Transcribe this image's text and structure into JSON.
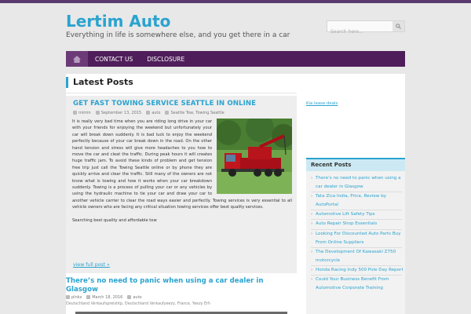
{
  "site": {
    "title": "Lertim Auto",
    "tagline": "Everything in life is somewhere else, and you get there in a car"
  },
  "search": {
    "placeholder": "Search here..."
  },
  "nav": {
    "items": [
      "CONTACT US",
      "DISCLOSURE"
    ]
  },
  "main": {
    "section_title": "Latest Posts"
  },
  "post1": {
    "title": "GET FAST TOWING SERVICE SEATTLE IN ONLINE",
    "author": "mimin",
    "date": "September 13, 2015",
    "category": "auto",
    "tags": "Seattle Tow, Towing Seattle",
    "body": "It is really very bad time when you are riding long drive in your car with your friends for enjoying the weekend but unfortunately your car will break down suddenly. It is bad luck to enjoy the weekend perfectly because of your car break down in the road. On the other hand tension and stress will give more headaches to you how to move the car and cleat the traffic. During peak hours it will creates huge traffic jam. To avoid these kinds of problem and get tension free trip just call the Towing Seattle online or by phone they are quickly arrive and clear the traffic. Still many of the owners are not know what is towing and how it works when your car breakdown suddenly. Towing is a process of pulling your car or any vehicles by using the hydraulic machine to tie your car and draw your car to another vehicle carrier to clear the road ways easier and perfectly. Towing services is very essential to all vehicle owners who are facing any critical situation towing services offer best quality services.",
    "body2": "Searching best quality and affordable tow",
    "view_full": "view full post »"
  },
  "post2": {
    "title": "There’s no need to panic when using a car dealer in Glasgow",
    "author": "plnks",
    "date": "March 18, 2016",
    "category": "auto",
    "tags": "Deutschland Verkaufspreishtp, Deutschland Verkaufyeezy, France, Yeezy Erh"
  },
  "sidebar": {
    "link": "Kia lease deals",
    "widget_title": "Recent Posts",
    "recent": [
      "There’s no need to panic when using a",
      "car dealer in Glasgow",
      "Tata Zica India, Price, Review by",
      "AutoPortal",
      "Automotive Lift Safety Tips",
      "Auto Repair Shop Essentials",
      "Looking For Discounted Auto Parts Buy",
      "From Online Suppliers",
      "The Development Of Kawasaki Z750",
      "motorcycle",
      "Honda Racing Indy 500 Pole Day Report",
      "Could Your Business Benefit From",
      "Automotive Corporate Training"
    ]
  },
  "colors": {
    "accent": "#2aa3cf",
    "nav": "#4f1e5a",
    "nav_home": "#6c3b77"
  },
  "icons": {
    "home": "home-icon",
    "search": "search-icon"
  }
}
